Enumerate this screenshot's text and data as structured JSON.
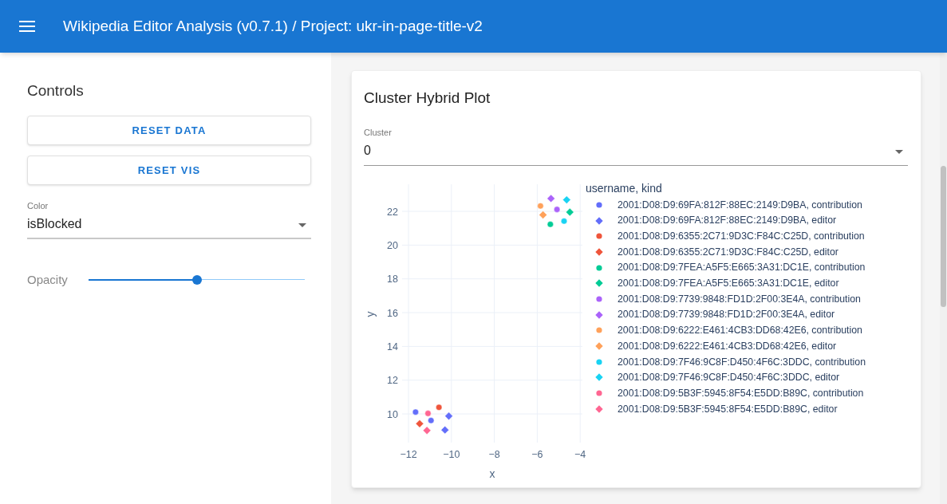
{
  "app_bar": {
    "title": "Wikipedia Editor Analysis (v0.7.1) / Project: ukr-in-page-title-v2"
  },
  "controls": {
    "title": "Controls",
    "buttons": [
      "RESET DATA",
      "RESET VIS"
    ],
    "color_select": {
      "label": "Color",
      "value": "isBlocked"
    },
    "opacity": {
      "label": "Opacity",
      "level": 0.5
    }
  },
  "card": {
    "title": "Cluster Hybrid Plot",
    "cluster_select": {
      "label": "Cluster",
      "value": "0"
    },
    "chart_data": {
      "type": "scatter",
      "xlabel": "x",
      "ylabel": "y",
      "legend": {
        "title": "username, kind"
      },
      "grid": true,
      "xlim": [
        -12.3,
        -3.9
      ],
      "ylim": [
        8.3,
        23.6
      ],
      "xticks": [
        {
          "value": -12,
          "label": "−12"
        },
        {
          "value": -10,
          "label": "−10"
        },
        {
          "value": -8,
          "label": "−8"
        },
        {
          "value": -6,
          "label": "−6"
        },
        {
          "value": -4,
          "label": "−4"
        }
      ],
      "yticks": [
        10,
        12,
        14,
        16,
        18,
        20,
        22
      ],
      "series": [
        {
          "name": "2001:D08:D9:69FA:812F:88EC:2149:D9BA, contribution",
          "marker": "circle",
          "color": "#636efa",
          "x": [
            -11.67,
            -10.95
          ],
          "values": [
            10.11,
            9.61
          ]
        },
        {
          "name": "2001:D08:D9:69FA:812F:88EC:2149:D9BA, editor",
          "marker": "diamond",
          "color": "#636efa",
          "x": [
            -10.12,
            -10.3
          ],
          "values": [
            9.87,
            9.05
          ]
        },
        {
          "name": "2001:D08:D9:6355:2C71:9D3C:F84C:C25D, contribution",
          "marker": "circle",
          "color": "#ef553b",
          "x": [
            -10.58
          ],
          "values": [
            10.39
          ]
        },
        {
          "name": "2001:D08:D9:6355:2C71:9D3C:F84C:C25D, editor",
          "marker": "diamond",
          "color": "#ef553b",
          "x": [
            -11.48
          ],
          "values": [
            9.42
          ]
        },
        {
          "name": "2001:D08:D9:7FEA:A5F5:E665:3A31:DC1E, contribution",
          "marker": "circle",
          "color": "#00cc96",
          "x": [
            -5.39
          ],
          "values": [
            21.23
          ]
        },
        {
          "name": "2001:D08:D9:7FEA:A5F5:E665:3A31:DC1E, editor",
          "marker": "diamond",
          "color": "#00cc96",
          "x": [
            -4.48
          ],
          "values": [
            21.95
          ]
        },
        {
          "name": "2001:D08:D9:7739:9848:FD1D:2F00:3E4A, contribution",
          "marker": "circle",
          "color": "#ab63fa",
          "x": [
            -5.08
          ],
          "values": [
            22.11
          ]
        },
        {
          "name": "2001:D08:D9:7739:9848:FD1D:2F00:3E4A, editor",
          "marker": "diamond",
          "color": "#ab63fa",
          "x": [
            -5.36
          ],
          "values": [
            22.76
          ]
        },
        {
          "name": "2001:D08:D9:6222:E461:4CB3:DD68:42E6, contribution",
          "marker": "circle",
          "color": "#ffa15a",
          "x": [
            -5.85
          ],
          "values": [
            22.32
          ]
        },
        {
          "name": "2001:D08:D9:6222:E461:4CB3:DD68:42E6, editor",
          "marker": "diamond",
          "color": "#ffa15a",
          "x": [
            -5.73
          ],
          "values": [
            21.79
          ]
        },
        {
          "name": "2001:D08:D9:7F46:9C8F:D450:4F6C:3DDC, contribution",
          "marker": "circle",
          "color": "#19d3f3",
          "x": [
            -4.75
          ],
          "values": [
            21.42
          ]
        },
        {
          "name": "2001:D08:D9:7F46:9C8F:D450:4F6C:3DDC, editor",
          "marker": "diamond",
          "color": "#19d3f3",
          "x": [
            -4.63
          ],
          "values": [
            22.68
          ]
        },
        {
          "name": "2001:D08:D9:5B3F:5945:8F54:E5DD:B89C, contribution",
          "marker": "circle",
          "color": "#ff6692",
          "x": [
            -11.09
          ],
          "values": [
            10.03
          ]
        },
        {
          "name": "2001:D08:D9:5B3F:5945:8F54:E5DD:B89C, editor",
          "marker": "diamond",
          "color": "#ff6692",
          "x": [
            -11.14
          ],
          "values": [
            9.02
          ]
        }
      ]
    }
  }
}
